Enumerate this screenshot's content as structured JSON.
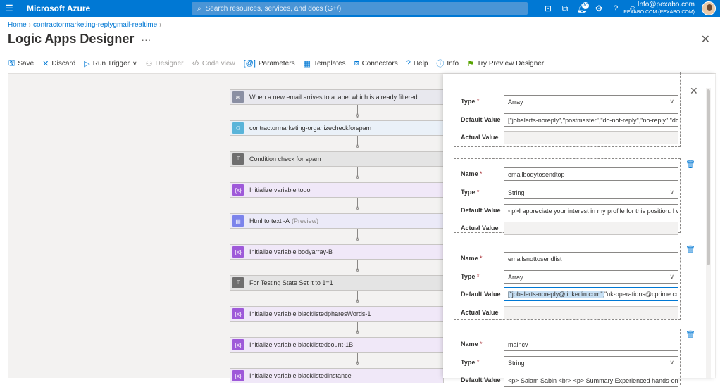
{
  "header": {
    "brand": "Microsoft Azure",
    "search_placeholder": "Search resources, services, and docs (G+/)",
    "notifications": "10",
    "account_email": "Info@pexabo.com",
    "account_dir": "PEXABO.COM (PEXABO.COM)"
  },
  "breadcrumb": {
    "home": "Home",
    "app": "contractormarketing-replygmail-realtime"
  },
  "page": {
    "title": "Logic Apps Designer",
    "more": "···"
  },
  "toolbar": {
    "save": "Save",
    "discard": "Discard",
    "run": "Run Trigger",
    "designer": "Designer",
    "code": "Code view",
    "parameters": "Parameters",
    "templates": "Templates",
    "connectors": "Connectors",
    "help": "Help",
    "info": "Info",
    "preview": "Try Preview Designer"
  },
  "steps": [
    {
      "label": "When a new email arrives to a label which is already filtered",
      "icon": "gmail-icon",
      "color": "#e8e8ee",
      "iconbg": "#8a8fa3"
    },
    {
      "label": "contractormarketing-organizecheckforspam",
      "icon": "workflow-icon",
      "color": "#eaf1f8",
      "iconbg": "#59b4d9"
    },
    {
      "label": "Condition check for spam",
      "icon": "condition-icon",
      "color": "#e4e4e4",
      "iconbg": "#6e6e6e"
    },
    {
      "label": "Initialize variable todo",
      "icon": "variable-icon",
      "color": "#f0e8f8",
      "iconbg": "#9e59d9"
    },
    {
      "label": "Html to text -A",
      "suffix": "(Preview)",
      "icon": "html-icon",
      "color": "#ebeaf8",
      "iconbg": "#7b83eb"
    },
    {
      "label": "Initialize variable bodyarray-B",
      "icon": "variable-icon",
      "color": "#f0e8f8",
      "iconbg": "#9e59d9"
    },
    {
      "label": "For Testing State Set it to 1=1",
      "icon": "condition-icon",
      "color": "#e4e4e4",
      "iconbg": "#6e6e6e"
    },
    {
      "label": "Initialize variable blacklistedpharesWords-1",
      "icon": "variable-icon",
      "color": "#f0e8f8",
      "iconbg": "#9e59d9"
    },
    {
      "label": "Initialize variable blacklistedcount-1B",
      "icon": "variable-icon",
      "color": "#f0e8f8",
      "iconbg": "#9e59d9"
    },
    {
      "label": "Initialize variable blacklistedinstance",
      "icon": "variable-icon",
      "color": "#f0e8f8",
      "iconbg": "#9e59d9"
    }
  ],
  "labels": {
    "name": "Name",
    "type": "Type",
    "default": "Default Value",
    "actual": "Actual Value",
    "req": "*"
  },
  "params": [
    {
      "type": "Array",
      "default": "[\"jobalerts-noreply\",\"postmaster\",\"do-not-reply\",\"no-reply\",\"do..."
    },
    {
      "name": "emailbodytosendtop",
      "type": "String",
      "default": "<p>I appreciate your interest in my profile for this position. I w..."
    },
    {
      "name": "emailsnottosendlist",
      "type": "Array",
      "default_hl": "[\"jobalerts-noreply@linkedin.com\",",
      "default_rest": "\"uk-operations@cprime.com\","
    },
    {
      "name": "maincv",
      "type": "String",
      "default": "<p> Salam Sabin <br> <p> Summary Experienced hands-on pro"
    }
  ]
}
